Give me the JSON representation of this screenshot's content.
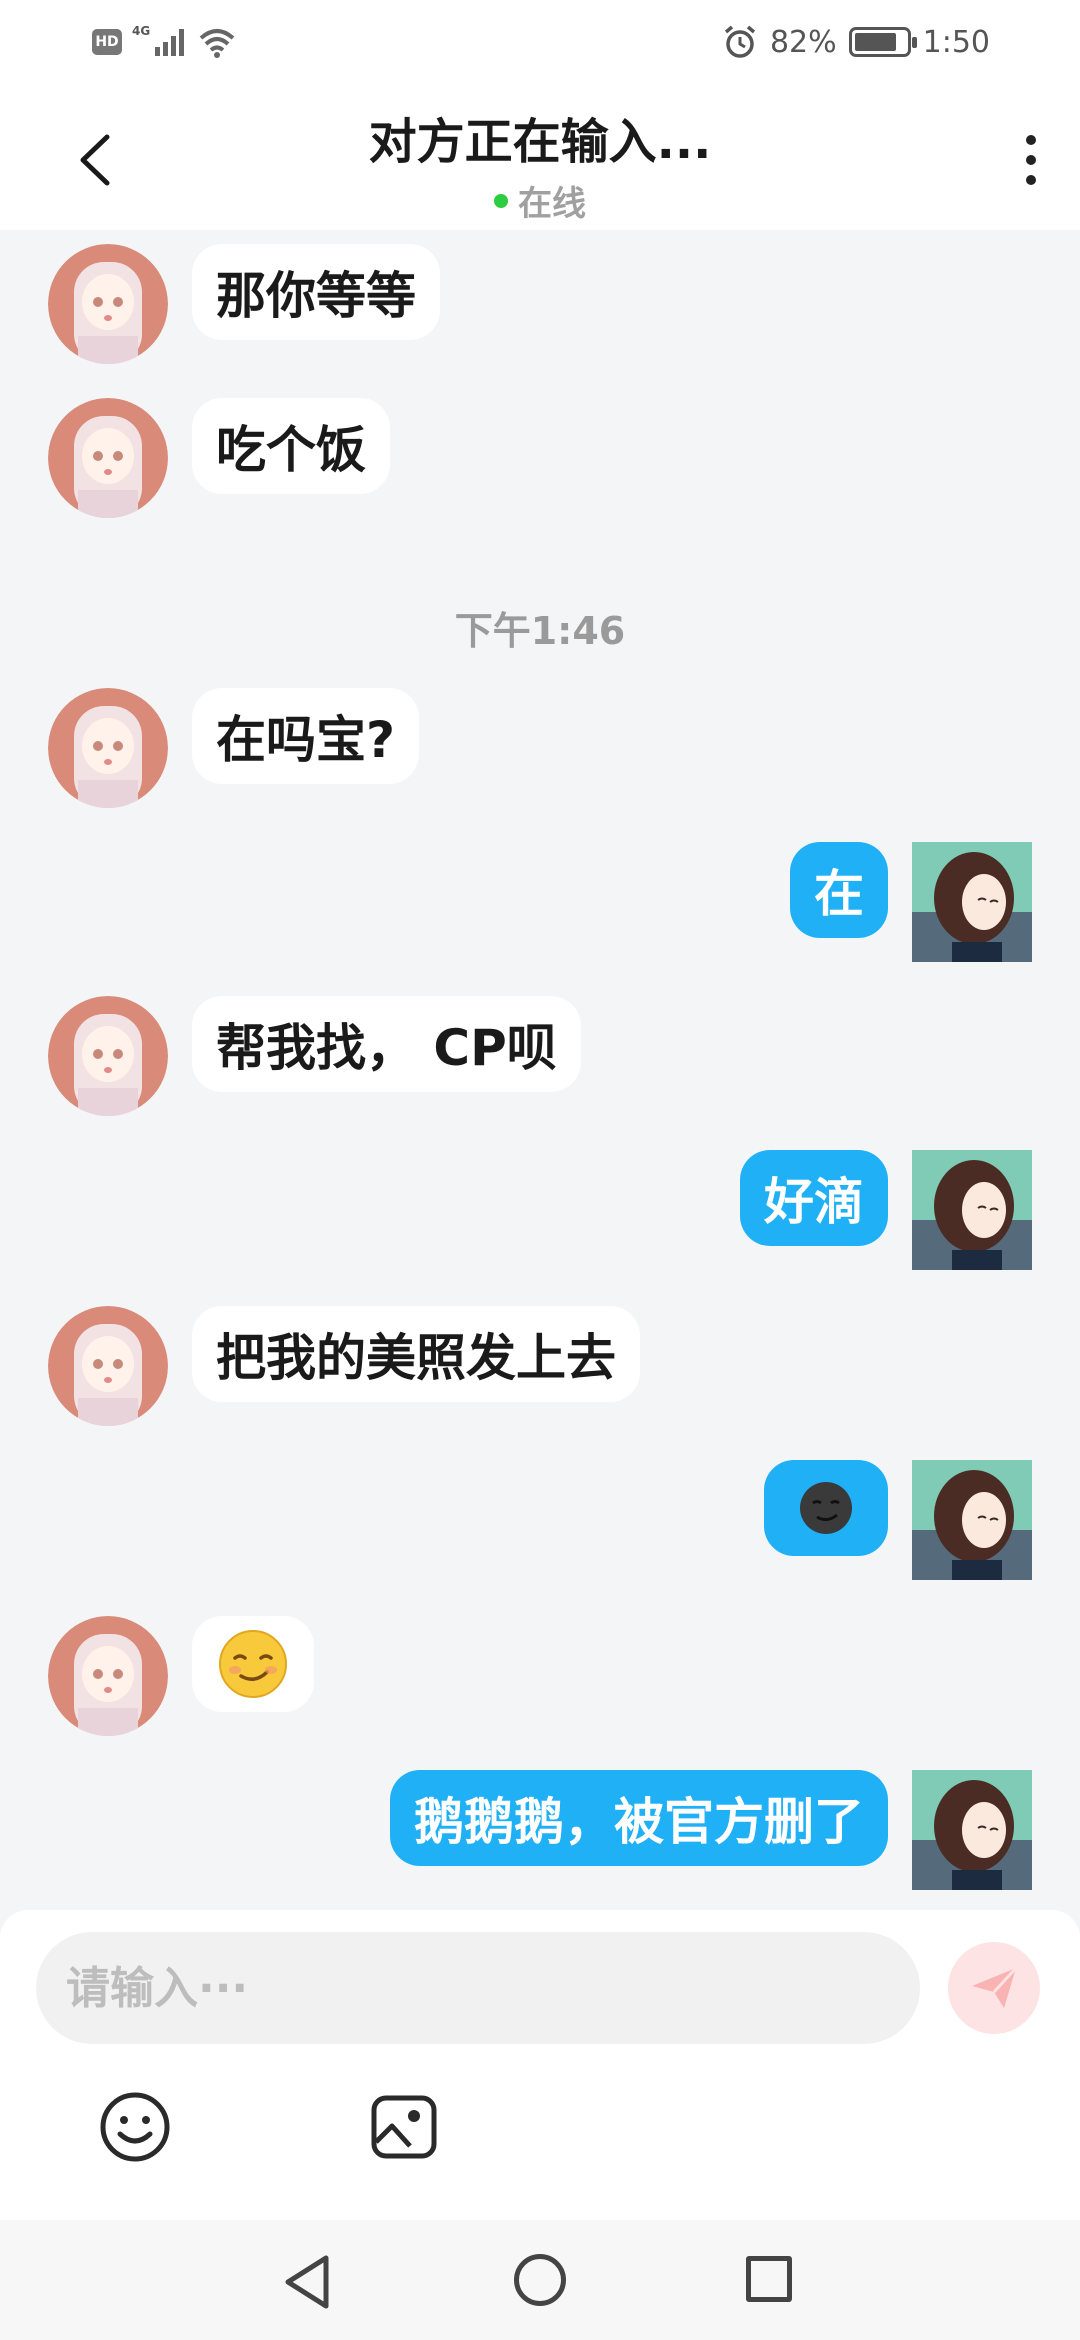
{
  "status_bar": {
    "hd": "HD",
    "network": "4G",
    "battery_text": "82%",
    "battery_level": 0.82,
    "time": "1:50"
  },
  "header": {
    "title": "对方正在输入...",
    "status": "在线",
    "status_color": "#2ecc40"
  },
  "messages": [
    {
      "from": "her",
      "text": "那你等等"
    },
    {
      "from": "her",
      "text": "吃个饭"
    },
    {
      "type": "timestamp",
      "text": "下午1:46"
    },
    {
      "from": "her",
      "text": "在吗宝?"
    },
    {
      "from": "me",
      "text": "在"
    },
    {
      "from": "her",
      "text": "帮我找， CP呗"
    },
    {
      "from": "me",
      "text": "好滴"
    },
    {
      "from": "her",
      "text": "把我的美照发上去"
    },
    {
      "from": "me",
      "emoji": "smirk-dark-face"
    },
    {
      "from": "her",
      "emoji": "smirk-yellow-face"
    },
    {
      "from": "me",
      "text": "鹅鹅鹅，被官方删了"
    }
  ],
  "composer": {
    "placeholder": "请输入···",
    "send_icon": "paper-plane-icon",
    "tools": [
      "emoji-icon",
      "image-icon"
    ]
  },
  "colors": {
    "accent_bubble": "#20b0f6",
    "send_button_bg": "#fde3e3",
    "background": "#f4f5f7"
  }
}
